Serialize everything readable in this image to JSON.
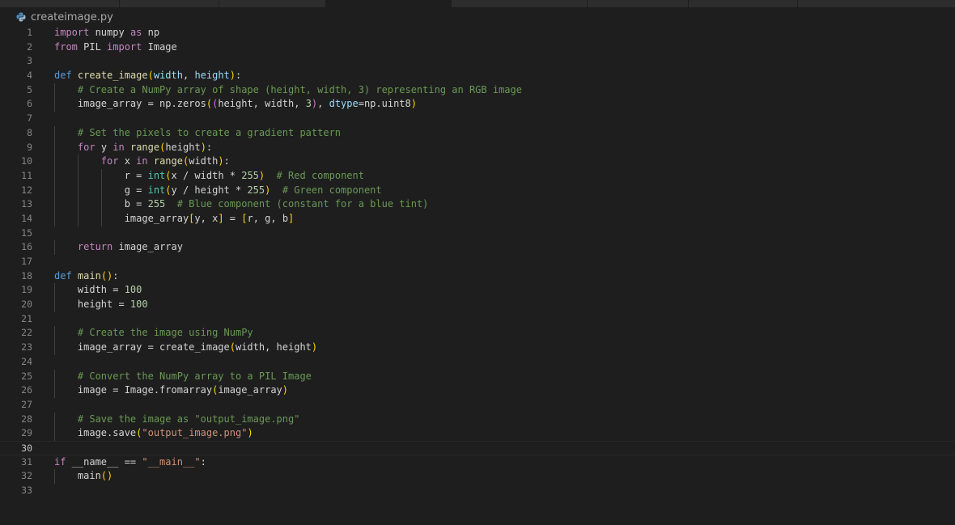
{
  "editor": {
    "filename": "createimage.py",
    "current_line": 30,
    "lines": [
      {
        "n": "1",
        "tokens": [
          [
            "ctl",
            "import"
          ],
          [
            "pn",
            " numpy "
          ],
          [
            "ctl",
            "as"
          ],
          [
            "pn",
            " np"
          ]
        ]
      },
      {
        "n": "2",
        "tokens": [
          [
            "ctl",
            "from"
          ],
          [
            "pn",
            " PIL "
          ],
          [
            "ctl",
            "import"
          ],
          [
            "pn",
            " Image"
          ]
        ]
      },
      {
        "n": "3",
        "tokens": []
      },
      {
        "n": "4",
        "tokens": [
          [
            "kw",
            "def"
          ],
          [
            "pn",
            " "
          ],
          [
            "fn",
            "create_image"
          ],
          [
            "b1",
            "("
          ],
          [
            "var",
            "width"
          ],
          [
            "pn",
            ", "
          ],
          [
            "var",
            "height"
          ],
          [
            "b1",
            ")"
          ],
          [
            "pn",
            ":"
          ]
        ]
      },
      {
        "n": "5",
        "guides": 1,
        "tokens": [
          [
            "pn",
            "    "
          ],
          [
            "cm",
            "# Create a NumPy array of shape (height, width, 3) representing an RGB image"
          ]
        ]
      },
      {
        "n": "6",
        "guides": 1,
        "tokens": [
          [
            "pn",
            "    image_array = np.zeros"
          ],
          [
            "b1",
            "("
          ],
          [
            "b2",
            "("
          ],
          [
            "pn",
            "height, width, "
          ],
          [
            "num",
            "3"
          ],
          [
            "b2",
            ")"
          ],
          [
            "pn",
            ", "
          ],
          [
            "var",
            "dtype"
          ],
          [
            "pn",
            "=np.uint8"
          ],
          [
            "b1",
            ")"
          ]
        ]
      },
      {
        "n": "7",
        "guides": 1,
        "tokens": []
      },
      {
        "n": "8",
        "guides": 1,
        "tokens": [
          [
            "pn",
            "    "
          ],
          [
            "cm",
            "# Set the pixels to create a gradient pattern"
          ]
        ]
      },
      {
        "n": "9",
        "guides": 1,
        "tokens": [
          [
            "pn",
            "    "
          ],
          [
            "ctl",
            "for"
          ],
          [
            "pn",
            " y "
          ],
          [
            "ctl",
            "in"
          ],
          [
            "pn",
            " "
          ],
          [
            "fn",
            "range"
          ],
          [
            "b1",
            "("
          ],
          [
            "pn",
            "height"
          ],
          [
            "b1",
            ")"
          ],
          [
            "pn",
            ":"
          ]
        ]
      },
      {
        "n": "10",
        "guides": 2,
        "tokens": [
          [
            "pn",
            "        "
          ],
          [
            "ctl",
            "for"
          ],
          [
            "pn",
            " x "
          ],
          [
            "ctl",
            "in"
          ],
          [
            "pn",
            " "
          ],
          [
            "fn",
            "range"
          ],
          [
            "b1",
            "("
          ],
          [
            "pn",
            "width"
          ],
          [
            "b1",
            ")"
          ],
          [
            "pn",
            ":"
          ]
        ]
      },
      {
        "n": "11",
        "guides": 3,
        "tokens": [
          [
            "pn",
            "            r = "
          ],
          [
            "ty",
            "int"
          ],
          [
            "b1",
            "("
          ],
          [
            "pn",
            "x / width * "
          ],
          [
            "num",
            "255"
          ],
          [
            "b1",
            ")"
          ],
          [
            "pn",
            "  "
          ],
          [
            "cm",
            "# Red component"
          ]
        ]
      },
      {
        "n": "12",
        "guides": 3,
        "tokens": [
          [
            "pn",
            "            g = "
          ],
          [
            "ty",
            "int"
          ],
          [
            "b1",
            "("
          ],
          [
            "pn",
            "y / height * "
          ],
          [
            "num",
            "255"
          ],
          [
            "b1",
            ")"
          ],
          [
            "pn",
            "  "
          ],
          [
            "cm",
            "# Green component"
          ]
        ]
      },
      {
        "n": "13",
        "guides": 3,
        "tokens": [
          [
            "pn",
            "            b = "
          ],
          [
            "num",
            "255"
          ],
          [
            "pn",
            "  "
          ],
          [
            "cm",
            "# Blue component (constant for a blue tint)"
          ]
        ]
      },
      {
        "n": "14",
        "guides": 3,
        "tokens": [
          [
            "pn",
            "            image_array"
          ],
          [
            "b1",
            "["
          ],
          [
            "pn",
            "y, x"
          ],
          [
            "b1",
            "]"
          ],
          [
            "pn",
            " = "
          ],
          [
            "b1",
            "["
          ],
          [
            "pn",
            "r, g, b"
          ],
          [
            "b1",
            "]"
          ]
        ]
      },
      {
        "n": "15",
        "guides": 1,
        "tokens": []
      },
      {
        "n": "16",
        "guides": 1,
        "tokens": [
          [
            "pn",
            "    "
          ],
          [
            "ctl",
            "return"
          ],
          [
            "pn",
            " image_array"
          ]
        ]
      },
      {
        "n": "17",
        "tokens": []
      },
      {
        "n": "18",
        "tokens": [
          [
            "kw",
            "def"
          ],
          [
            "pn",
            " "
          ],
          [
            "fn",
            "main"
          ],
          [
            "b1",
            "()"
          ],
          [
            "pn",
            ":"
          ]
        ]
      },
      {
        "n": "19",
        "guides": 1,
        "tokens": [
          [
            "pn",
            "    width = "
          ],
          [
            "num",
            "100"
          ]
        ]
      },
      {
        "n": "20",
        "guides": 1,
        "tokens": [
          [
            "pn",
            "    height = "
          ],
          [
            "num",
            "100"
          ]
        ]
      },
      {
        "n": "21",
        "guides": 1,
        "tokens": []
      },
      {
        "n": "22",
        "guides": 1,
        "tokens": [
          [
            "pn",
            "    "
          ],
          [
            "cm",
            "# Create the image using NumPy"
          ]
        ]
      },
      {
        "n": "23",
        "guides": 1,
        "tokens": [
          [
            "pn",
            "    image_array = create_image"
          ],
          [
            "b1",
            "("
          ],
          [
            "pn",
            "width, height"
          ],
          [
            "b1",
            ")"
          ]
        ]
      },
      {
        "n": "24",
        "guides": 1,
        "tokens": []
      },
      {
        "n": "25",
        "guides": 1,
        "tokens": [
          [
            "pn",
            "    "
          ],
          [
            "cm",
            "# Convert the NumPy array to a PIL Image"
          ]
        ]
      },
      {
        "n": "26",
        "guides": 1,
        "tokens": [
          [
            "pn",
            "    image = Image.fromarray"
          ],
          [
            "b1",
            "("
          ],
          [
            "pn",
            "image_array"
          ],
          [
            "b1",
            ")"
          ]
        ]
      },
      {
        "n": "27",
        "guides": 1,
        "tokens": []
      },
      {
        "n": "28",
        "guides": 1,
        "tokens": [
          [
            "pn",
            "    "
          ],
          [
            "cm",
            "# Save the image as \"output_image.png\""
          ]
        ]
      },
      {
        "n": "29",
        "guides": 1,
        "tokens": [
          [
            "pn",
            "    image.save"
          ],
          [
            "b1",
            "("
          ],
          [
            "str",
            "\"output_image.png\""
          ],
          [
            "b1",
            ")"
          ]
        ]
      },
      {
        "n": "30",
        "guides": 1,
        "tokens": []
      },
      {
        "n": "31",
        "tokens": [
          [
            "ctl",
            "if"
          ],
          [
            "pn",
            " __name__ == "
          ],
          [
            "str",
            "\"__main__\""
          ],
          [
            "pn",
            ":"
          ]
        ]
      },
      {
        "n": "32",
        "guides": 1,
        "tokens": [
          [
            "pn",
            "    main"
          ],
          [
            "b1",
            "()"
          ]
        ]
      },
      {
        "n": "33",
        "tokens": []
      }
    ]
  },
  "icons": {
    "file_icon": "python-file-icon"
  },
  "colors": {
    "background": "#1e1e1e",
    "keyword": "#569cd6",
    "control": "#c586c0",
    "function": "#dcdcaa",
    "comment": "#6a9955",
    "number": "#b5cea8",
    "string": "#ce9178"
  }
}
